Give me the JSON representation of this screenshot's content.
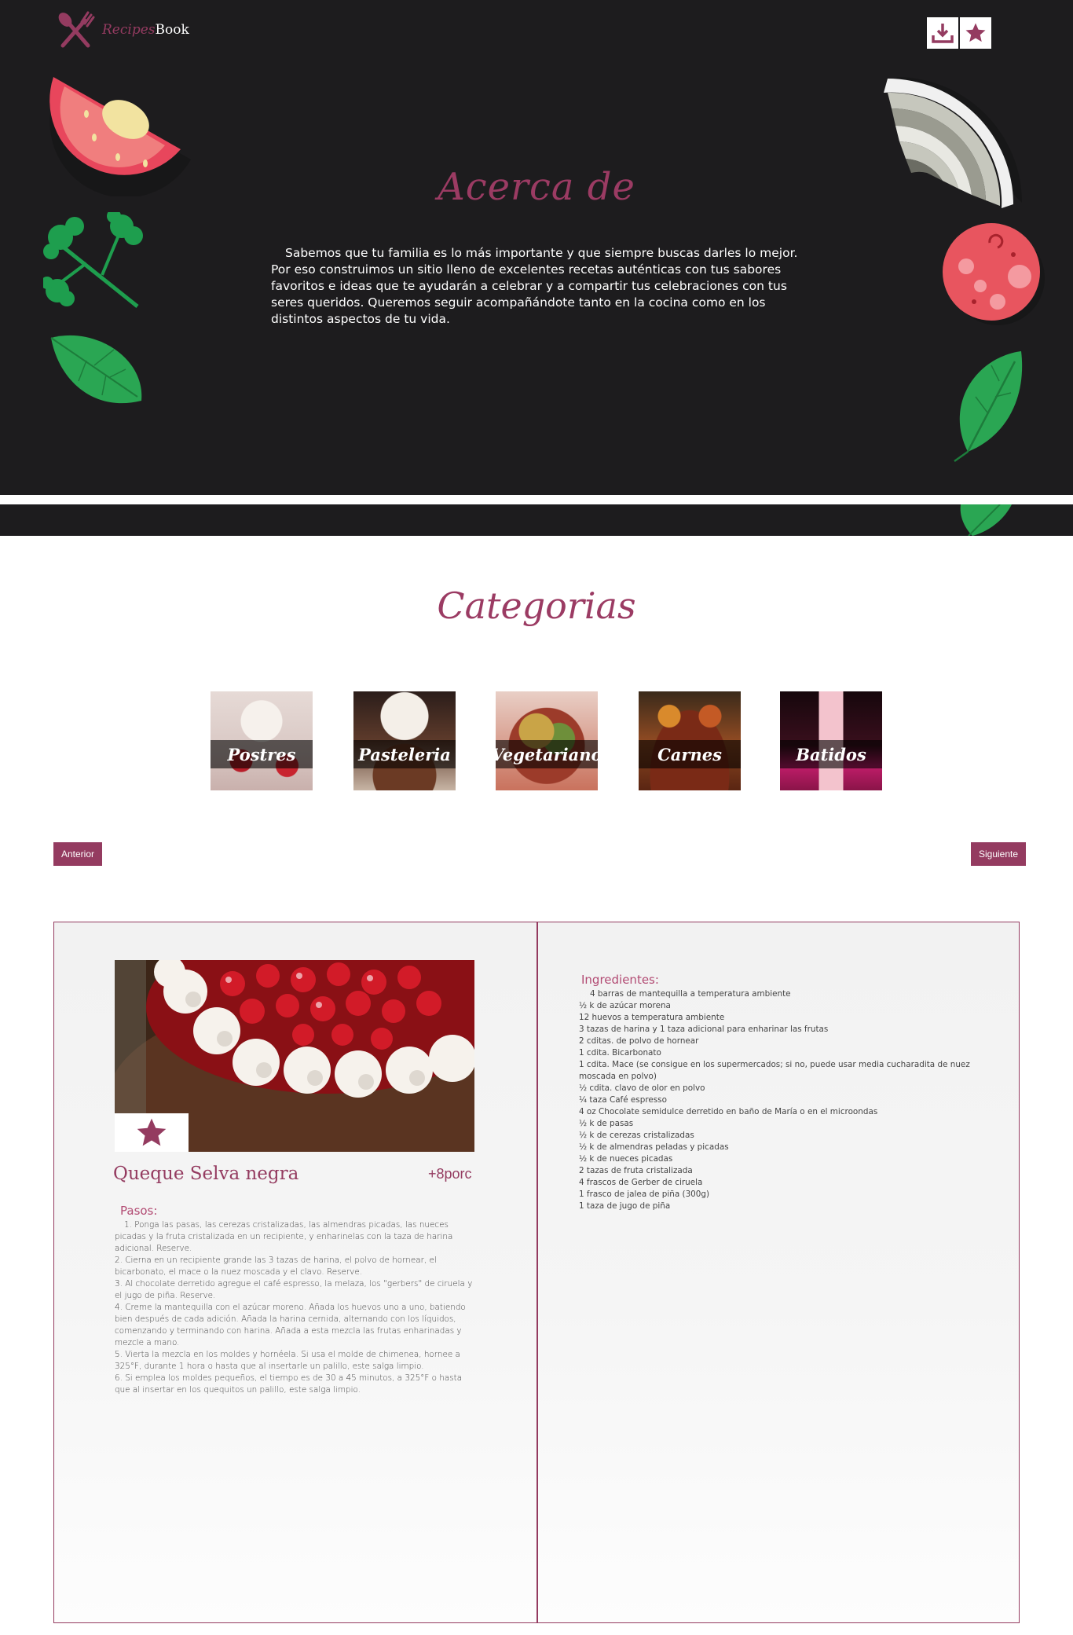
{
  "brand": {
    "name_part1": "Recipes",
    "name_part2": "Book"
  },
  "header_actions": {
    "download": "download-icon",
    "favorites": "star-icon"
  },
  "about": {
    "title": "Acerca de",
    "text": "Sabemos que tu familia es lo más importante y que siempre buscas darles lo mejor. Por eso construimos un sitio lleno de excelentes recetas auténticas con tus sabores favoritos e ideas que te ayudarán a celebrar y a compartir tus celebraciones con tus seres queridos. Queremos seguir acompañándote tanto en la cocina como en los distintos aspectos de tu vida."
  },
  "categories": {
    "title": "Categorias",
    "items": [
      {
        "label": "Postres"
      },
      {
        "label": "Pasteleria"
      },
      {
        "label": "Vegetariano"
      },
      {
        "label": "Carnes"
      },
      {
        "label": "Batidos"
      }
    ]
  },
  "navigation": {
    "prev": "Anterior",
    "next": "Siguiente"
  },
  "recipe": {
    "name": "Queque Selva negra",
    "portions": "+8porc",
    "steps_title": "Pasos:",
    "steps": [
      "1. Ponga las pasas, las cerezas cristalizadas, las almendras picadas, las nueces picadas y la fruta cristalizada en un recipiente, y enharinelas con la taza de harina adicional. Reserve.",
      "2. Cierna en un recipiente grande las 3 tazas de harina, el polvo de hornear, el bicarbonato, el mace o la nuez moscada y el clavo. Reserve.",
      "3. Al chocolate derretido agregue el café espresso, la melaza, los \"gerbers\" de ciruela y el jugo de piña. Reserve.",
      "4. Creme la mantequilla con el azúcar moreno. Añada los huevos uno a uno, batiendo bien después de cada adición. Añada la harina cernida, alternando con los líquidos, comenzando y terminando con harina. Añada a esta mezcla las frutas enharinadas y mezcle a mano.",
      "5. Vierta la mezcla en los moldes y hornéela. Si usa el molde de chimenea, hornee a 325°F, durante 1 hora o hasta que al insertarle un palillo, este salga limpio.",
      "6. Si emplea los moldes pequeños, el tiempo es de 30 a 45 minutos, a 325°F o hasta que al insertar en los quequitos un palillo, este salga limpio."
    ],
    "ingredients_title": "Ingredientes:",
    "ingredients": [
      "4 barras de mantequilla a temperatura ambiente",
      "½ k de azúcar morena",
      "12 huevos a temperatura ambiente",
      "3 tazas de harina y 1 taza adicional para enharinar las frutas",
      "2 cditas. de polvo de hornear",
      "1 cdita. Bicarbonato",
      "1 cdita. Mace (se consigue en los supermercados; si no, puede usar media cucharadita de nuez moscada en polvo)",
      "½ cdita. clavo de olor en polvo",
      "¼ taza Café espresso",
      "4 oz Chocolate semidulce derretido en baño de María o en el microondas",
      "½ k de pasas",
      "½ k de cerezas cristalizadas",
      "½ k de almendras peladas y picadas",
      "½ k de nueces picadas",
      "2 tazas de fruta cristalizada",
      "4 frascos de Gerber de ciruela",
      "1 frasco de jalea de piña (300g)",
      "1 taza de jugo de piña"
    ]
  },
  "colors": {
    "brand": "#943b60",
    "dark_bg": "#1d1c1e"
  }
}
